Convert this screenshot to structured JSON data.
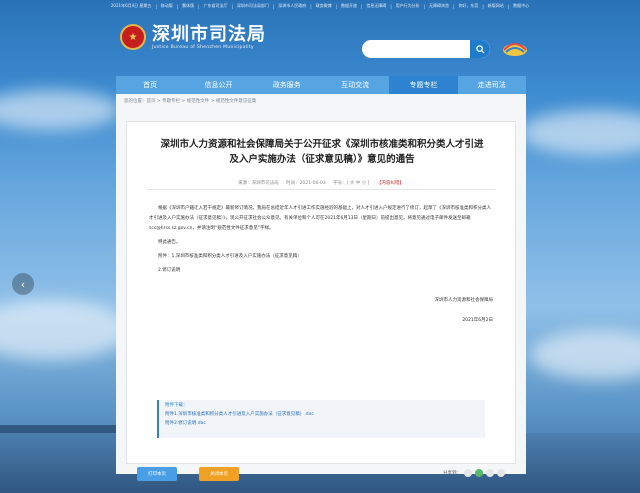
{
  "topbar": {
    "items": [
      "2021年6月4日 星期五",
      "|",
      "移动版",
      "|",
      "繁体版",
      "|",
      "广东省司法厅",
      "|",
      "深圳市司法局部门",
      "|",
      "深圳市人民政府",
      "|",
      "政务微博",
      "|",
      "数据开放",
      "|",
      "信息无障碍",
      "|",
      "用户行为分析",
      "|",
      "无障碍浏览",
      "|",
      "你好，东莞",
      "|",
      "新版网站",
      "|",
      "数据中心"
    ]
  },
  "header": {
    "logo_cn": "深圳市司法局",
    "logo_en": "Justice Bureau of Shenzhen Municipality",
    "search_placeholder": ""
  },
  "nav": {
    "items": [
      "首页",
      "信息公开",
      "政务服务",
      "互动交流",
      "专题专栏",
      "走进司法"
    ]
  },
  "breadcrumb": "您的位置：首页 > 专题专栏 > 规范性文件 > 规范性文件意见征集",
  "article": {
    "title": "深圳市人力资源和社会保障局关于公开征求《深圳市核准类和积分类人才引进及入户实施办法（征求意见稿）》意见的通告",
    "meta_source": "来源：深圳市司法局",
    "meta_date": "时间：2021-06-03",
    "meta_font": "字号：[ 大  中  小 ]",
    "meta_print": "【内容纠错】",
    "para1": "根据《深圳市户籍迁入若干规定》最新修订情况，我局在总结近年人才引进工作实施经验的基础上，对人才引进入户规定进行了修订，起草了《深圳市核准类和积分类人才引进及入户实施办法（征求意见稿）》，现公开征求社会公众意见。有关单位和个人可在2021年6月13日（星期日）前提出意见，将意见通过电子邮件发送至邮箱scc@hrss.sz.gov.cn，并请注明“规范性文件征求意见”字样。",
    "para2": "特此通告。",
    "para3": "附件：1.深圳市核准类和积分类人才引进及入户实施办法（征求意见稿）",
    "para4": "2.修订说明",
    "sign_org": "深圳市人力资源和社会保障局",
    "sign_date": "2021年6月2日"
  },
  "attachments": {
    "title": "附件下载：",
    "files": [
      "附件1.深圳市核准类和积分类人才引进及入户实施办法（征求意见稿）.doc",
      "附件2.修订说明.doc"
    ]
  },
  "actions": {
    "print": "打印本页",
    "close": "关闭本页",
    "share_label": "分享到："
  },
  "colors": {
    "nav_bg": "#56a5e2",
    "nav_active": "#2d83cf",
    "print_btn": "#4a9ee6",
    "close_btn": "#f0a025"
  }
}
